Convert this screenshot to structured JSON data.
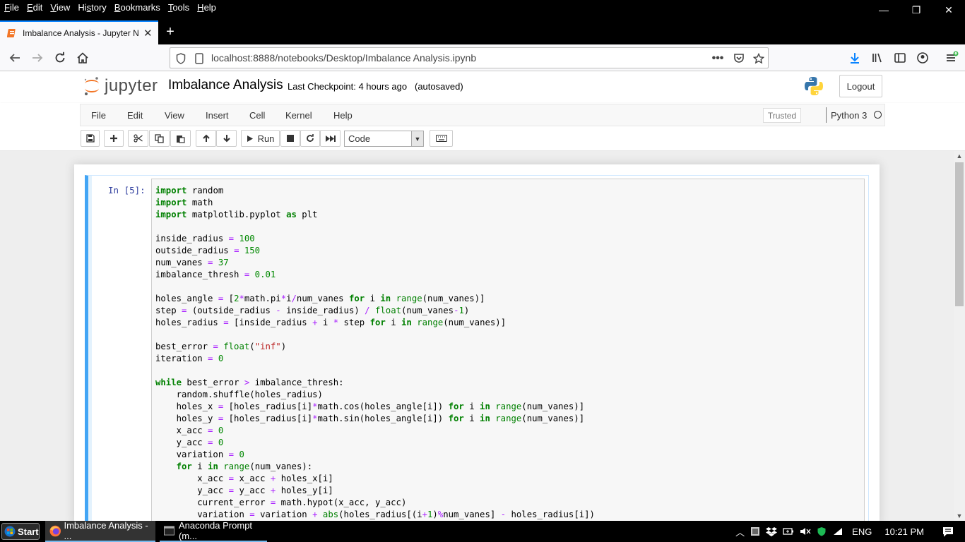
{
  "browser": {
    "menu": [
      "File",
      "Edit",
      "View",
      "History",
      "Bookmarks",
      "Tools",
      "Help"
    ],
    "menu_accel": [
      "F",
      "E",
      "V",
      "s",
      "B",
      "T",
      "H"
    ],
    "window_controls": {
      "minimize": "—",
      "restore": "❐",
      "close": "✕"
    },
    "tab_title": "Imbalance Analysis - Jupyter N",
    "tab_close": "✕",
    "new_tab": "+",
    "url": "localhost:8888/notebooks/Desktop/Imbalance Analysis.ipynb",
    "accent": "#0a84ff"
  },
  "jupyter": {
    "wordmark": "jupyter",
    "notebook_name": "Imbalance Analysis",
    "checkpoint": "Last Checkpoint: 4 hours ago",
    "autosave": "(autosaved)",
    "logout": "Logout",
    "menu": [
      "File",
      "Edit",
      "View",
      "Insert",
      "Cell",
      "Kernel",
      "Help"
    ],
    "trusted": "Trusted",
    "kernel_name": "Python 3",
    "toolbar": {
      "run_label": "Run",
      "cell_type": "Code"
    },
    "cell": {
      "prompt": "In [5]:",
      "code_lines": [
        [
          [
            "kw",
            "import"
          ],
          [
            "t",
            " random"
          ]
        ],
        [
          [
            "kw",
            "import"
          ],
          [
            "t",
            " math"
          ]
        ],
        [
          [
            "kw",
            "import"
          ],
          [
            "t",
            " matplotlib.pyplot "
          ],
          [
            "kw",
            "as"
          ],
          [
            "t",
            " plt"
          ]
        ],
        [],
        [
          [
            "t",
            "inside_radius "
          ],
          [
            "op",
            "="
          ],
          [
            "t",
            " "
          ],
          [
            "num",
            "100"
          ]
        ],
        [
          [
            "t",
            "outside_radius "
          ],
          [
            "op",
            "="
          ],
          [
            "t",
            " "
          ],
          [
            "num",
            "150"
          ]
        ],
        [
          [
            "t",
            "num_vanes "
          ],
          [
            "op",
            "="
          ],
          [
            "t",
            " "
          ],
          [
            "num",
            "37"
          ]
        ],
        [
          [
            "t",
            "imbalance_thresh "
          ],
          [
            "op",
            "="
          ],
          [
            "t",
            " "
          ],
          [
            "num",
            "0.01"
          ]
        ],
        [],
        [
          [
            "t",
            "holes_angle "
          ],
          [
            "op",
            "="
          ],
          [
            "t",
            " ["
          ],
          [
            "num",
            "2"
          ],
          [
            "op",
            "*"
          ],
          [
            "t",
            "math.pi"
          ],
          [
            "op",
            "*"
          ],
          [
            "t",
            "i"
          ],
          [
            "op",
            "/"
          ],
          [
            "t",
            "num_vanes "
          ],
          [
            "kw",
            "for"
          ],
          [
            "t",
            " i "
          ],
          [
            "kw",
            "in"
          ],
          [
            "t",
            " "
          ],
          [
            "bi",
            "range"
          ],
          [
            "t",
            "(num_vanes)]"
          ]
        ],
        [
          [
            "t",
            "step "
          ],
          [
            "op",
            "="
          ],
          [
            "t",
            " (outside_radius "
          ],
          [
            "op",
            "-"
          ],
          [
            "t",
            " inside_radius) "
          ],
          [
            "op",
            "/"
          ],
          [
            "t",
            " "
          ],
          [
            "bi",
            "float"
          ],
          [
            "t",
            "(num_vanes"
          ],
          [
            "op",
            "-"
          ],
          [
            "num",
            "1"
          ],
          [
            "t",
            ")"
          ]
        ],
        [
          [
            "t",
            "holes_radius "
          ],
          [
            "op",
            "="
          ],
          [
            "t",
            " [inside_radius "
          ],
          [
            "op",
            "+"
          ],
          [
            "t",
            " i "
          ],
          [
            "op",
            "*"
          ],
          [
            "t",
            " step "
          ],
          [
            "kw",
            "for"
          ],
          [
            "t",
            " i "
          ],
          [
            "kw",
            "in"
          ],
          [
            "t",
            " "
          ],
          [
            "bi",
            "range"
          ],
          [
            "t",
            "(num_vanes)]"
          ]
        ],
        [],
        [
          [
            "t",
            "best_error "
          ],
          [
            "op",
            "="
          ],
          [
            "t",
            " "
          ],
          [
            "bi",
            "float"
          ],
          [
            "t",
            "("
          ],
          [
            "str",
            "\"inf\""
          ],
          [
            "t",
            ")"
          ]
        ],
        [
          [
            "t",
            "iteration "
          ],
          [
            "op",
            "="
          ],
          [
            "t",
            " "
          ],
          [
            "num",
            "0"
          ]
        ],
        [],
        [
          [
            "kw",
            "while"
          ],
          [
            "t",
            " best_error "
          ],
          [
            "op",
            ">"
          ],
          [
            "t",
            " imbalance_thresh:"
          ]
        ],
        [
          [
            "t",
            "    random.shuffle(holes_radius)"
          ]
        ],
        [
          [
            "t",
            "    holes_x "
          ],
          [
            "op",
            "="
          ],
          [
            "t",
            " [holes_radius[i]"
          ],
          [
            "op",
            "*"
          ],
          [
            "t",
            "math.cos(holes_angle[i]) "
          ],
          [
            "kw",
            "for"
          ],
          [
            "t",
            " i "
          ],
          [
            "kw",
            "in"
          ],
          [
            "t",
            " "
          ],
          [
            "bi",
            "range"
          ],
          [
            "t",
            "(num_vanes)]"
          ]
        ],
        [
          [
            "t",
            "    holes_y "
          ],
          [
            "op",
            "="
          ],
          [
            "t",
            " [holes_radius[i]"
          ],
          [
            "op",
            "*"
          ],
          [
            "t",
            "math.sin(holes_angle[i]) "
          ],
          [
            "kw",
            "for"
          ],
          [
            "t",
            " i "
          ],
          [
            "kw",
            "in"
          ],
          [
            "t",
            " "
          ],
          [
            "bi",
            "range"
          ],
          [
            "t",
            "(num_vanes)]"
          ]
        ],
        [
          [
            "t",
            "    x_acc "
          ],
          [
            "op",
            "="
          ],
          [
            "t",
            " "
          ],
          [
            "num",
            "0"
          ]
        ],
        [
          [
            "t",
            "    y_acc "
          ],
          [
            "op",
            "="
          ],
          [
            "t",
            " "
          ],
          [
            "num",
            "0"
          ]
        ],
        [
          [
            "t",
            "    variation "
          ],
          [
            "op",
            "="
          ],
          [
            "t",
            " "
          ],
          [
            "num",
            "0"
          ]
        ],
        [
          [
            "t",
            "    "
          ],
          [
            "kw",
            "for"
          ],
          [
            "t",
            " i "
          ],
          [
            "kw",
            "in"
          ],
          [
            "t",
            " "
          ],
          [
            "bi",
            "range"
          ],
          [
            "t",
            "(num_vanes):"
          ]
        ],
        [
          [
            "t",
            "        x_acc "
          ],
          [
            "op",
            "="
          ],
          [
            "t",
            " x_acc "
          ],
          [
            "op",
            "+"
          ],
          [
            "t",
            " holes_x[i]"
          ]
        ],
        [
          [
            "t",
            "        y_acc "
          ],
          [
            "op",
            "="
          ],
          [
            "t",
            " y_acc "
          ],
          [
            "op",
            "+"
          ],
          [
            "t",
            " holes_y[i]"
          ]
        ],
        [
          [
            "t",
            "        current_error "
          ],
          [
            "op",
            "="
          ],
          [
            "t",
            " math.hypot(x_acc, y_acc)"
          ]
        ],
        [
          [
            "t",
            "        variation "
          ],
          [
            "op",
            "="
          ],
          [
            "t",
            " variation "
          ],
          [
            "op",
            "+"
          ],
          [
            "t",
            " "
          ],
          [
            "bi",
            "abs"
          ],
          [
            "t",
            "(holes_radius[(i"
          ],
          [
            "op",
            "+"
          ],
          [
            "num",
            "1"
          ],
          [
            "t",
            ")"
          ],
          [
            "op",
            "%"
          ],
          [
            "t",
            "num_vanes] "
          ],
          [
            "op",
            "-"
          ],
          [
            "t",
            " holes_radius[i])"
          ]
        ]
      ]
    }
  },
  "taskbar": {
    "start": "Start",
    "tasks": [
      "Imbalance Analysis - ...",
      "Anaconda Prompt (m..."
    ],
    "lang": "ENG",
    "time": "10:21 PM"
  }
}
